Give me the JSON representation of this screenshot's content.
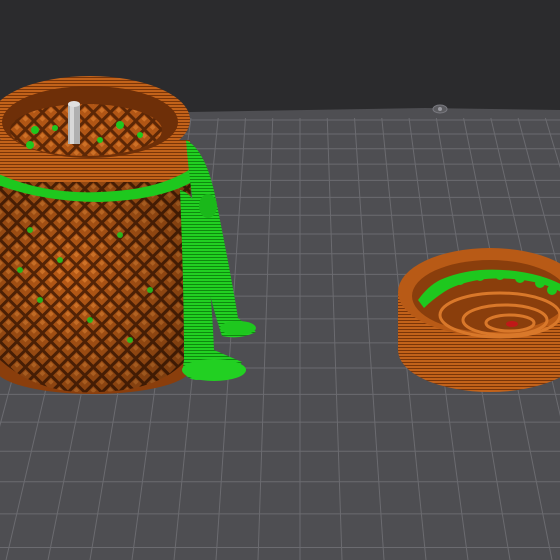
{
  "app": {
    "view": "3d-print-preview",
    "icons": [
      "build-plate-logo-icon"
    ]
  },
  "colors": {
    "background": "#2b2b2d",
    "plate": "#4e4e52",
    "grid_line": "#6b6b70",
    "perimeter_orange": "#c2621a",
    "perimeter_dark": "#8a3e0c",
    "support_green": "#1ec81e",
    "highlight_red": "#c01818"
  },
  "scene": {
    "objects": [
      {
        "name": "printed-basket",
        "feature": "perimeter"
      },
      {
        "name": "support-towers",
        "feature": "support"
      },
      {
        "name": "printed-lid",
        "feature": "perimeter"
      }
    ]
  }
}
